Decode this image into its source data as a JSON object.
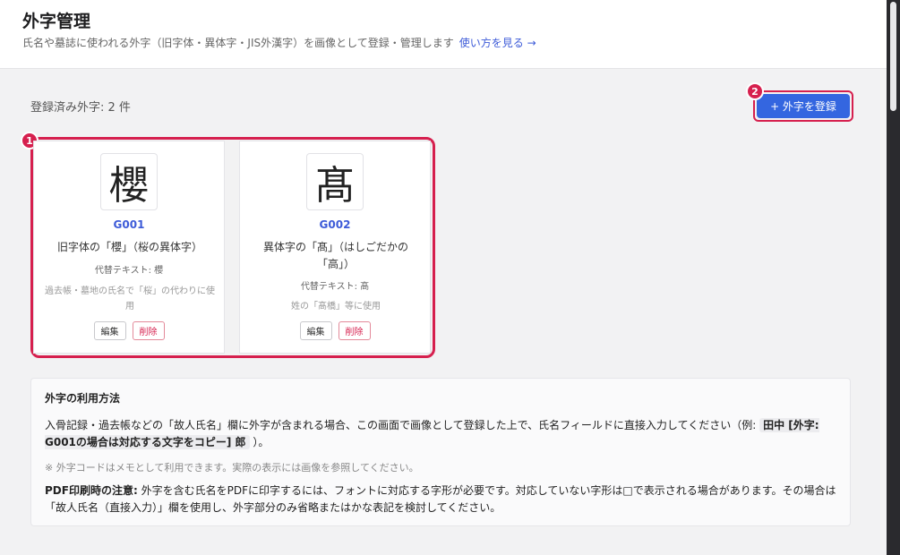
{
  "header": {
    "title": "外字管理",
    "subtitle": "氏名や墓誌に使われる外字（旧字体・異体字・JIS外漢字）を画像として登録・管理します",
    "help_link": "使い方を見る →"
  },
  "toolbar": {
    "count_label": "登録済み外字: 2 件",
    "register_label": "+ 外字を登録"
  },
  "annotations": {
    "badge1": "1",
    "badge2": "2"
  },
  "cards": [
    {
      "glyph": "櫻",
      "code": "G001",
      "description": "旧字体の「櫻」（桜の異体字）",
      "alt_text": "代替テキスト: 櫻",
      "note": "過去帳・墓地の氏名で「桜」の代わりに使用",
      "edit_label": "編集",
      "delete_label": "削除"
    },
    {
      "glyph": "髙",
      "code": "G002",
      "description": "異体字の「髙」（はしごだかの「高」）",
      "alt_text": "代替テキスト: 髙",
      "note": "姓の「髙橋」等に使用",
      "edit_label": "編集",
      "delete_label": "削除"
    }
  ],
  "usage": {
    "title": "外字の利用方法",
    "p1_text": "入骨記録・過去帳などの「故人氏名」欄に外字が含まれる場合、この画面で画像として登録した上で、氏名フィールドに直接入力してください（例:",
    "p1_code": "田中 [外字: G001の場合は対応する文字をコピー] 郎",
    "p1_end": "）。",
    "note": "※ 外字コードはメモとして利用できます。実際の表示には画像を参照してください。",
    "p2_bold": "PDF印刷時の注意:",
    "p2_text": "外字を含む氏名をPDFに印字するには、フォントに対応する字形が必要です。対応していない字形は□で表示される場合があります。その場合は「故人氏名（直接入力）」欄を使用し、外字部分のみ省略またはかな表記を検討してください。"
  },
  "colors": {
    "accent": "#3466e0",
    "highlight": "#d6204e",
    "code_link": "#3d5bd8"
  }
}
